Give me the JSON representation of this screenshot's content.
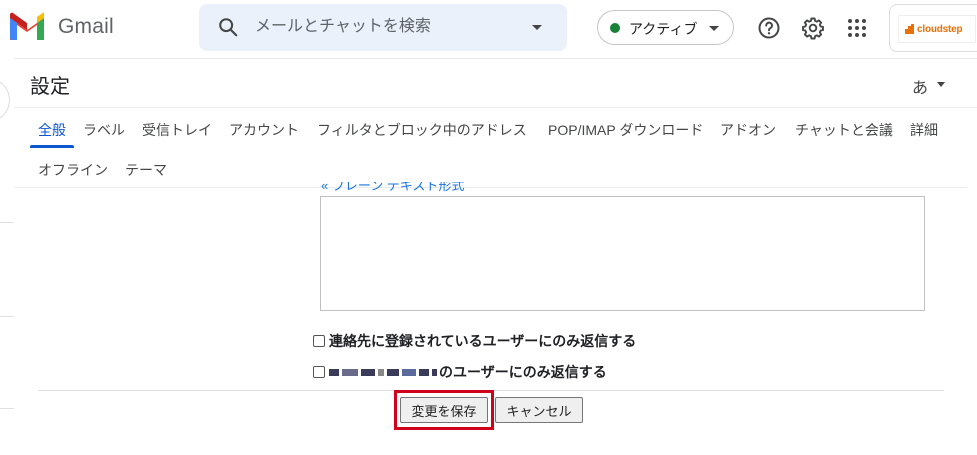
{
  "header": {
    "app_name": "Gmail",
    "search": {
      "placeholder": "メールとチャットを検索",
      "value": ""
    },
    "status": {
      "label": "アクティブ",
      "color": "#188038"
    },
    "icons": [
      "gmail-logo-icon",
      "search-icon",
      "chevron-down-icon",
      "help-icon",
      "gear-icon",
      "apps-grid-icon"
    ],
    "account_logo_text": "cloudstep"
  },
  "settings": {
    "title": "設定",
    "input_tool_label": "あ",
    "tabs": [
      {
        "label": "全般",
        "active": true
      },
      {
        "label": "ラベル"
      },
      {
        "label": "受信トレイ"
      },
      {
        "label": "アカウント"
      },
      {
        "label": "フィルタとブロック中のアドレス"
      },
      {
        "label": "POP/IMAP ダウンロード"
      },
      {
        "label": "アドオン"
      },
      {
        "label": "チャットと会議"
      },
      {
        "label": "詳細"
      },
      {
        "label": "オフライン"
      },
      {
        "label": "テーマ"
      }
    ]
  },
  "content": {
    "plaintext_link": "« プレーン テキスト形式",
    "signature_value": "",
    "checkbox_contacts_label": "連絡先に登録されているユーザーにのみ返信する",
    "checkbox_domain_label": "のユーザーにのみ返信する",
    "save_label": "変更を保存",
    "cancel_label": "キャンセル"
  },
  "colors": {
    "accent": "#0b57d0",
    "highlight": "#d0021b",
    "search_bg": "#eaf1fb"
  }
}
